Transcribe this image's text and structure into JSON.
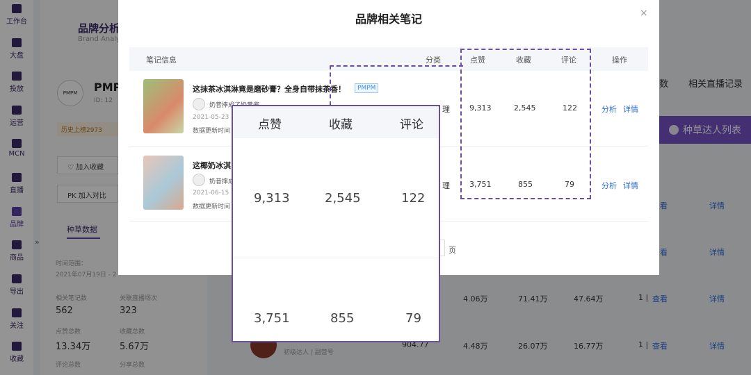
{
  "sidebar": {
    "items": [
      {
        "label": "工作台",
        "icon": "grid-icon"
      },
      {
        "label": "大盘",
        "icon": "pie-chart-icon"
      },
      {
        "label": "投放",
        "icon": "folder-icon"
      },
      {
        "label": "运营",
        "icon": "chat-icon"
      },
      {
        "label": "MCN",
        "icon": "mcn-icon"
      },
      {
        "label": "直播",
        "icon": "video-icon"
      },
      {
        "label": "品牌",
        "icon": "bag-icon"
      },
      {
        "label": "商品",
        "icon": "shop-icon"
      },
      {
        "label": "导出",
        "icon": "export-icon"
      },
      {
        "label": "关注",
        "icon": "eye-icon"
      },
      {
        "label": "收藏",
        "icon": "heart-icon"
      }
    ],
    "collapse": "»"
  },
  "background": {
    "title": "品牌分析",
    "subtitle": "Brand Analy",
    "brand_name": "PMP",
    "brand_logo_text": "PMPM",
    "brand_id": "ID: 12",
    "history": "历史上榜2973",
    "add_favorite": "加入收藏",
    "add_compare": "加入对比",
    "pk": "PK",
    "tab": "种草数据",
    "time_range_label": "时间范围：",
    "time_range_value": "2021年07月19日 - 2",
    "stats": [
      {
        "label": "相关笔记数",
        "value": "562"
      },
      {
        "label": "关联直播场次",
        "value": "323"
      },
      {
        "label": "点赞总数",
        "value": "13.34万"
      },
      {
        "label": "收藏总数",
        "value": "5.67万"
      },
      {
        "label": "评论总数",
        "value": ""
      },
      {
        "label": "分享总数",
        "value": ""
      }
    ],
    "right_tabs": [
      "数",
      "相关直播记录"
    ],
    "talent_button": "种草达人列表",
    "rows": [
      {
        "a": "",
        "b": "",
        "c": "",
        "view": "查看",
        "detail": "详情"
      },
      {
        "a": "",
        "b": "",
        "c": "",
        "view": "查看",
        "detail": "详情"
      },
      {
        "a": "4.06万",
        "b": "71.41万",
        "c": "47.64万",
        "count": "1 |",
        "view": "查看",
        "detail": "详情"
      },
      {
        "a": "4.48万",
        "b": "26.07万",
        "c": "16.77万",
        "count": "1 |",
        "view": "查看",
        "detail": "详情",
        "extra": "904.77"
      }
    ],
    "talent_label": "初级达人 | 副营号"
  },
  "modal": {
    "title": "品牌相关笔记",
    "close": "×",
    "headers": {
      "info": "笔记信息",
      "category": "分类",
      "likes": "点赞",
      "collects": "收藏",
      "comments": "评论",
      "actions": "操作"
    },
    "notes": [
      {
        "title": "这抹茶冰淇淋竟是磨砂膏？全身自带抹茶香！",
        "brand_tag": "PMPM",
        "author": "奶昔摔成了奶昔酱",
        "date": "2021-05-23",
        "update": "数据更新时间",
        "category": "理",
        "likes": "9,313",
        "collects": "2,545",
        "comments": "122",
        "analyze": "分析",
        "detail": "详情"
      },
      {
        "title": "这椰奶冰淇",
        "author": "奶昔摔成",
        "date": "2021-06-15",
        "update": "数据更新时间",
        "category": "理",
        "likes": "3,751",
        "collects": "855",
        "comments": "79",
        "analyze": "分析",
        "detail": "详情"
      }
    ],
    "pager_suffix": "页"
  },
  "colors": {
    "accent": "#6a4fa0",
    "link": "#2b6cd9",
    "purple_button": "#7552c7"
  }
}
